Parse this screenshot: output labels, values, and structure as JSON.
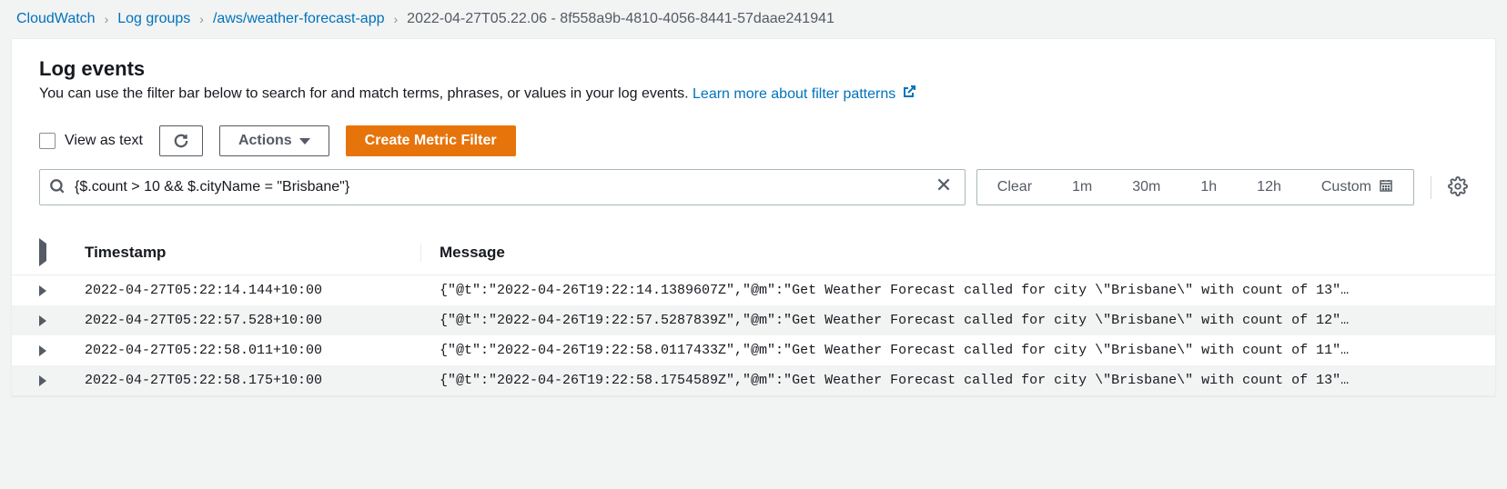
{
  "breadcrumb": {
    "root": "CloudWatch",
    "loggroups": "Log groups",
    "stream": "/aws/weather-forecast-app",
    "current": "2022-04-27T05.22.06 - 8f558a9b-4810-4056-8441-57daae241941"
  },
  "header": {
    "title": "Log events",
    "description": "You can use the filter bar below to search for and match terms, phrases, or values in your log events. ",
    "learn_more": "Learn more about filter patterns"
  },
  "toolbar": {
    "view_as_text": "View as text",
    "actions": "Actions",
    "create_filter": "Create Metric Filter"
  },
  "filter": {
    "value": "{$.count > 10 && $.cityName = \"Brisbane\"}"
  },
  "timebar": {
    "clear": "Clear",
    "t1": "1m",
    "t2": "30m",
    "t3": "1h",
    "t4": "12h",
    "custom": "Custom"
  },
  "table": {
    "col_timestamp": "Timestamp",
    "col_message": "Message",
    "rows": [
      {
        "ts": "2022-04-27T05:22:14.144+10:00",
        "msg": "{\"@t\":\"2022-04-26T19:22:14.1389607Z\",\"@m\":\"Get Weather Forecast called for city \\\"Brisbane\\\" with count of 13\"…"
      },
      {
        "ts": "2022-04-27T05:22:57.528+10:00",
        "msg": "{\"@t\":\"2022-04-26T19:22:57.5287839Z\",\"@m\":\"Get Weather Forecast called for city \\\"Brisbane\\\" with count of 12\"…"
      },
      {
        "ts": "2022-04-27T05:22:58.011+10:00",
        "msg": "{\"@t\":\"2022-04-26T19:22:58.0117433Z\",\"@m\":\"Get Weather Forecast called for city \\\"Brisbane\\\" with count of 11\"…"
      },
      {
        "ts": "2022-04-27T05:22:58.175+10:00",
        "msg": "{\"@t\":\"2022-04-26T19:22:58.1754589Z\",\"@m\":\"Get Weather Forecast called for city \\\"Brisbane\\\" with count of 13\"…"
      }
    ]
  }
}
